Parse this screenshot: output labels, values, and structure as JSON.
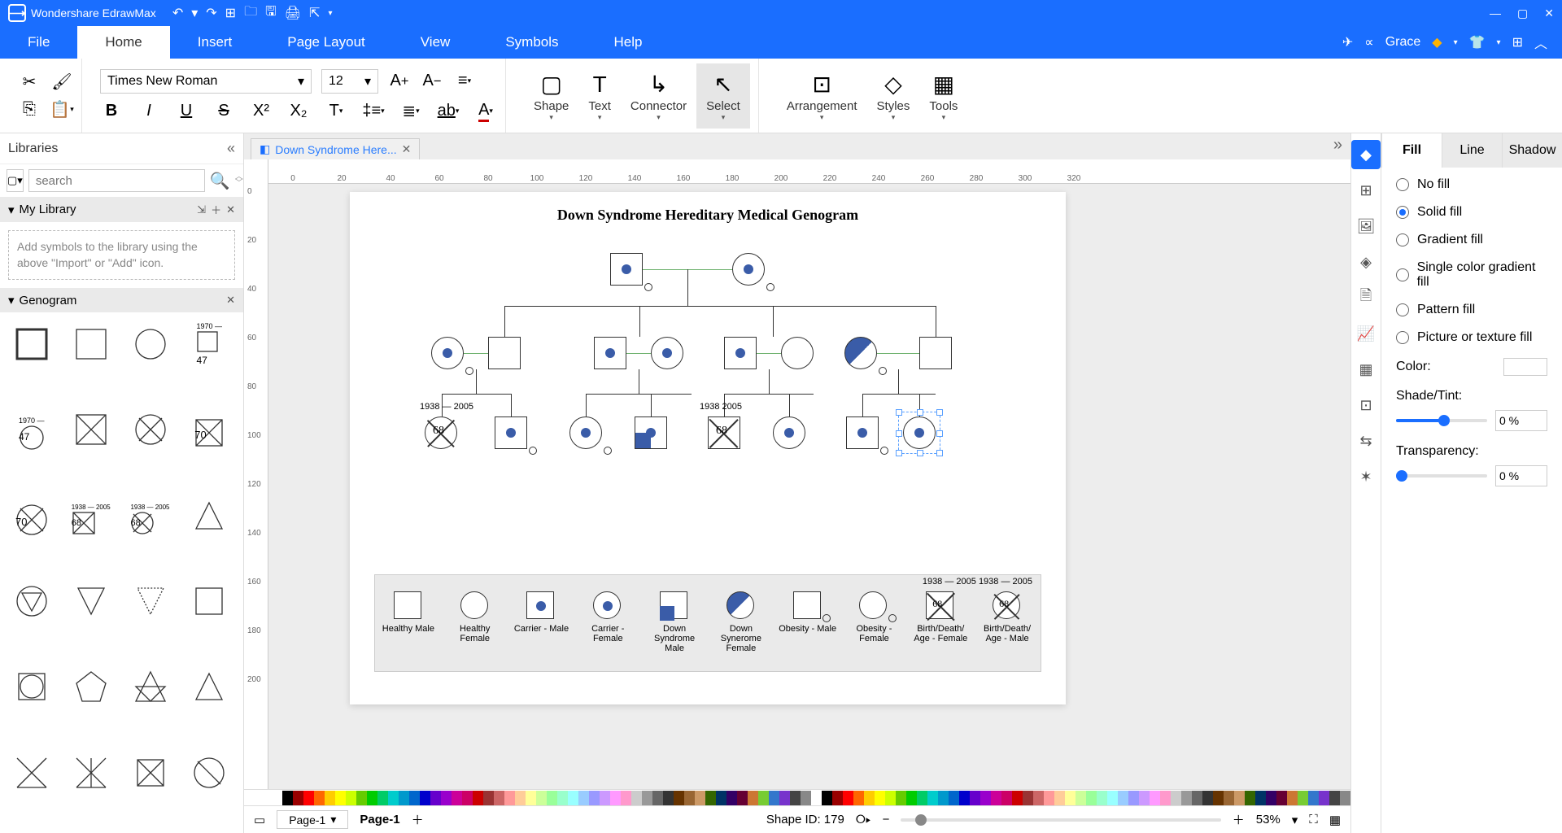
{
  "app": {
    "title": "Wondershare EdrawMax"
  },
  "menu": {
    "items": [
      "File",
      "Home",
      "Insert",
      "Page Layout",
      "View",
      "Symbols",
      "Help"
    ],
    "active": "Home",
    "user": "Grace"
  },
  "ribbon": {
    "font": "Times New Roman",
    "size": "12",
    "groups": [
      "Shape",
      "Text",
      "Connector",
      "Select",
      "Arrangement",
      "Styles",
      "Tools"
    ]
  },
  "libs": {
    "header": "Libraries",
    "search_placeholder": "search",
    "my_library": "My Library",
    "hint": "Add symbols to the library using the above \"Import\" or \"Add\" icon.",
    "genogram": "Genogram",
    "shape_labels": {
      "year1970": "1970 —",
      "age47": "47",
      "age70": "70",
      "age68": "68",
      "range": "1938 — 2005"
    }
  },
  "doc": {
    "tab": "Down Syndrome Here..."
  },
  "canvas": {
    "title": "Down Syndrome Hereditary Medical Genogram",
    "age68": "68",
    "dates": "1938 — 2005",
    "year_pair": "1938   2005",
    "ruler_h": [
      "0",
      "20",
      "40",
      "60",
      "80",
      "100",
      "120",
      "140",
      "160",
      "180",
      "200",
      "220",
      "240",
      "260",
      "280",
      "300",
      "320"
    ],
    "ruler_v": [
      "0",
      "20",
      "40",
      "60",
      "80",
      "100",
      "120",
      "140",
      "160",
      "180",
      "200"
    ]
  },
  "legend": {
    "items": [
      {
        "label": "Healthy Male"
      },
      {
        "label": "Healthy Female"
      },
      {
        "label": "Carrier - Male"
      },
      {
        "label": "Carrier - Female"
      },
      {
        "label": "Down Syndrome Male"
      },
      {
        "label": "Down Synerome Female"
      },
      {
        "label": "Obesity - Male"
      },
      {
        "label": "Obesity - Female"
      },
      {
        "label": "Birth/Death/ Age - Female"
      },
      {
        "label": "Birth/Death/ Age - Male"
      }
    ],
    "year_pair": "1938 — 2005 1938 — 2005",
    "age68": "68"
  },
  "props": {
    "tabs": [
      "Fill",
      "Line",
      "Shadow"
    ],
    "fill_options": [
      "No fill",
      "Solid fill",
      "Gradient fill",
      "Single color gradient fill",
      "Pattern fill",
      "Picture or texture fill"
    ],
    "fill_selected": "Solid fill",
    "color_label": "Color:",
    "shade_label": "Shade/Tint:",
    "shade_value": "0 %",
    "transparency_label": "Transparency:",
    "transparency_value": "0 %"
  },
  "status": {
    "page_label": "Page-1",
    "active_page": "Page-1",
    "shape_id": "Shape ID: 179",
    "zoom": "53%"
  }
}
